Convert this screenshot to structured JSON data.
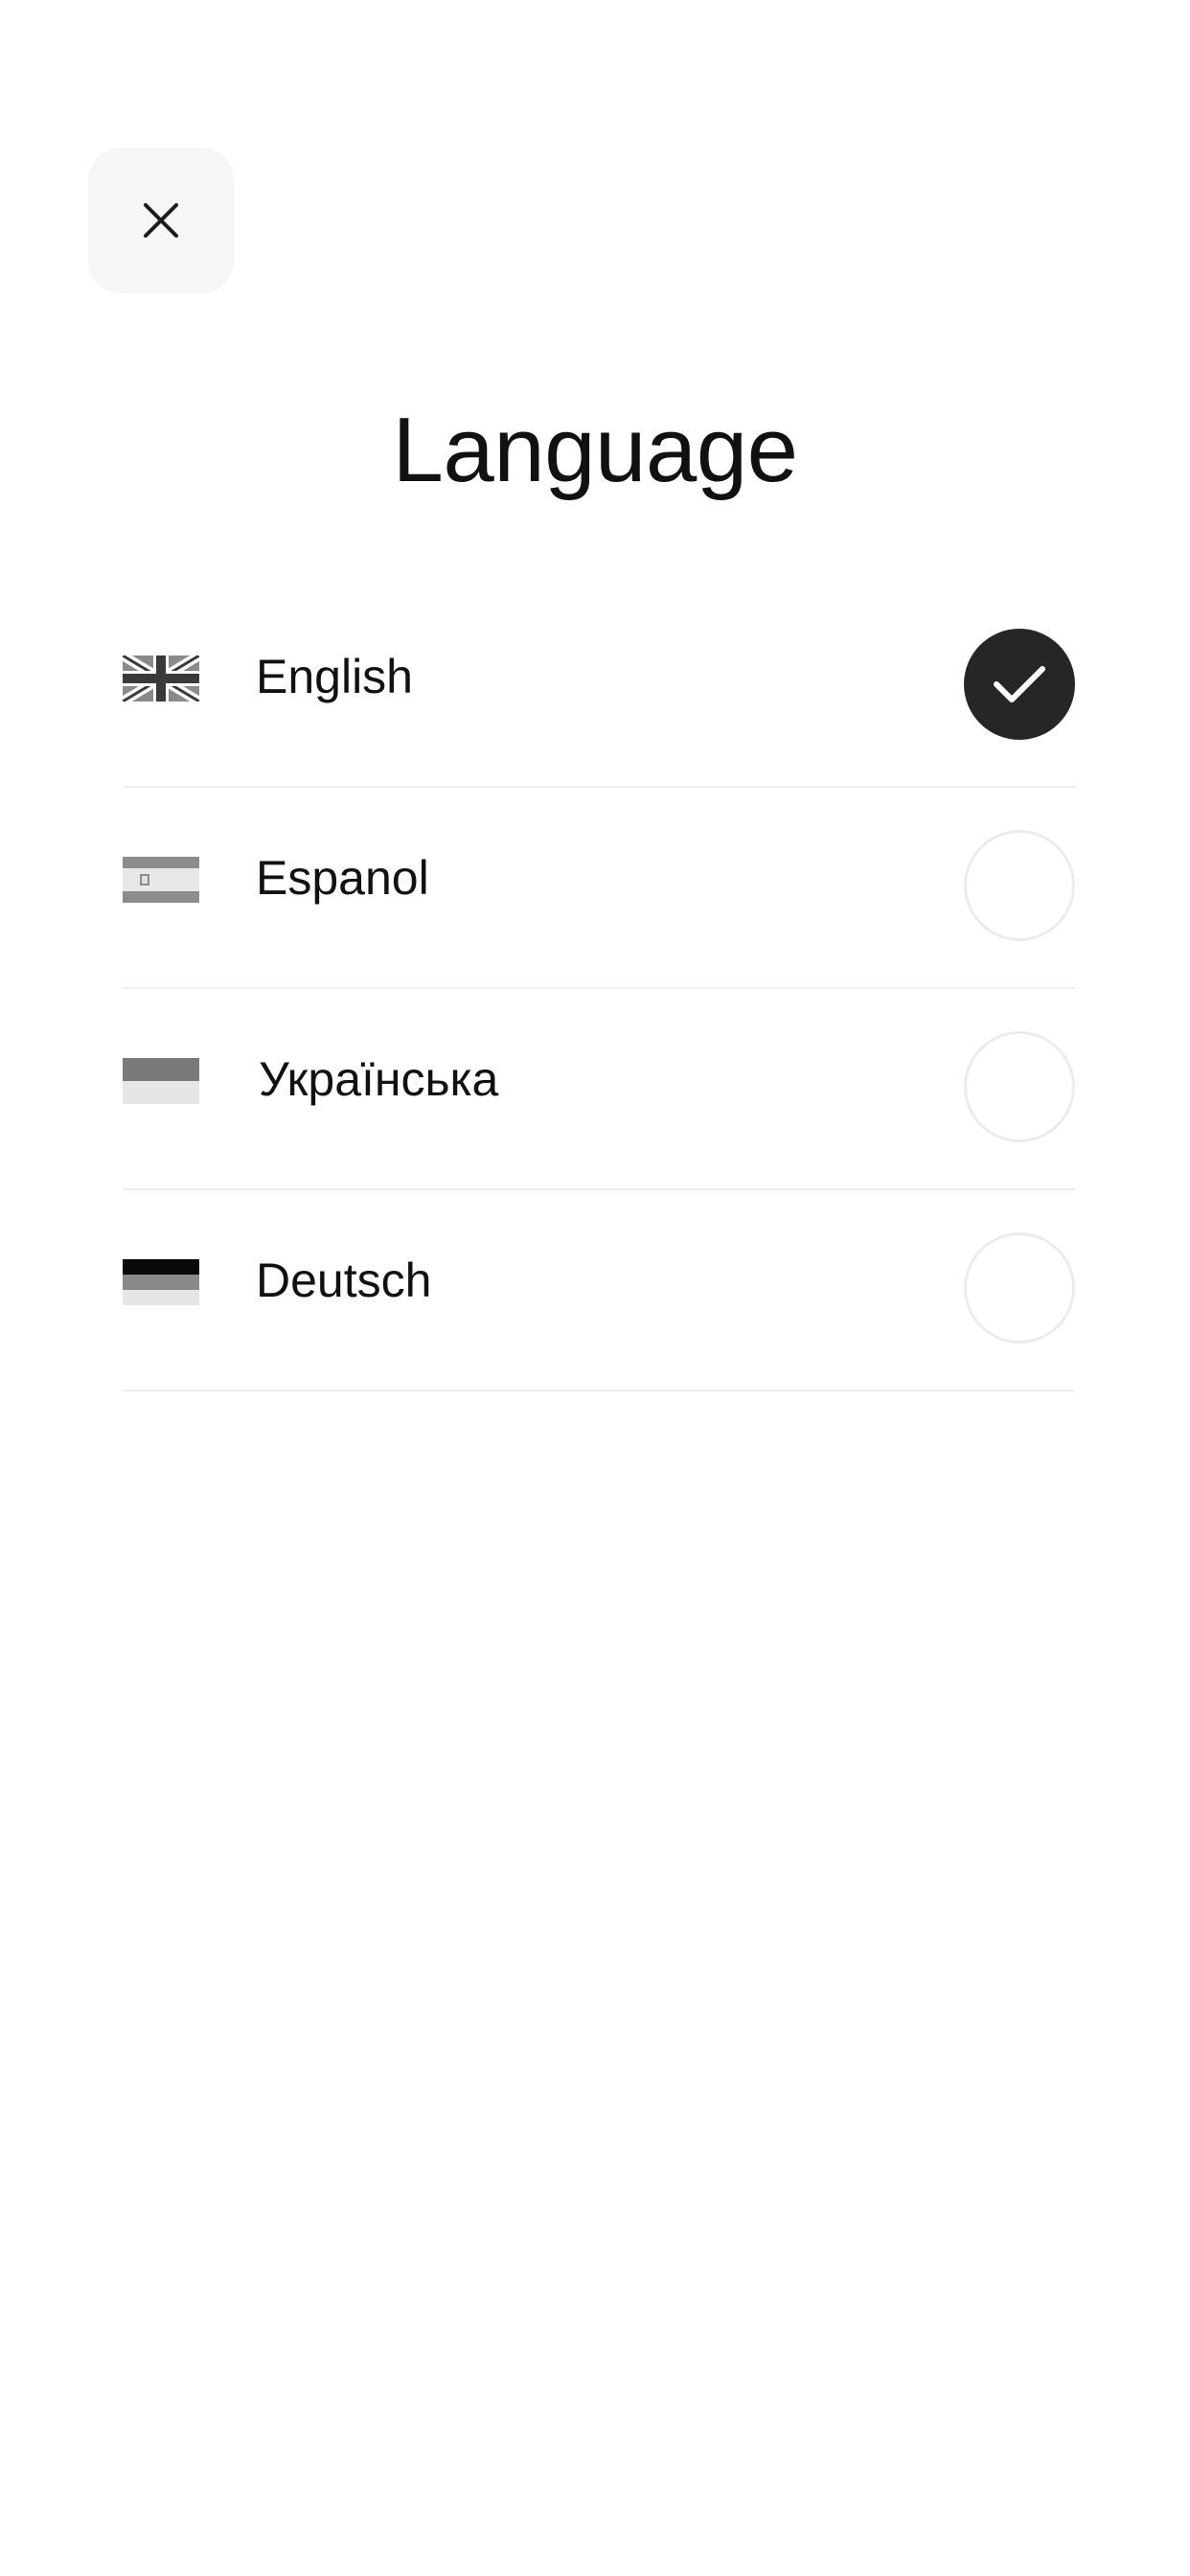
{
  "header": {
    "close_icon": "close-icon",
    "title": "Language"
  },
  "languages": [
    {
      "label": "English",
      "flag_icon": "uk-flag-icon",
      "selected": true
    },
    {
      "label": "Espanol",
      "flag_icon": "spain-flag-icon",
      "selected": false
    },
    {
      "label": "Українська",
      "flag_icon": "ukraine-flag-icon",
      "selected": false
    },
    {
      "label": "Deutsch",
      "flag_icon": "germany-flag-icon",
      "selected": false
    }
  ],
  "colors": {
    "selected_fill": "#262626",
    "radio_border": "#ececec",
    "close_bg": "#f5f6f8"
  }
}
